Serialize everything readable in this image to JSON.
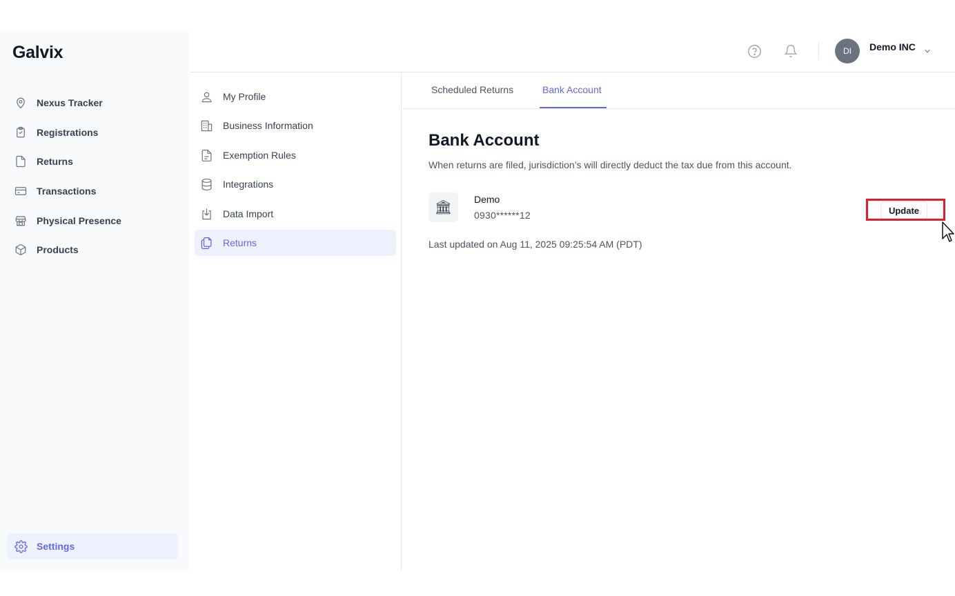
{
  "brand": {
    "logo": "Galvix"
  },
  "sidebar": {
    "items": [
      {
        "label": "Nexus Tracker",
        "icon": "map-pin-icon"
      },
      {
        "label": "Registrations",
        "icon": "clipboard-icon"
      },
      {
        "label": "Returns",
        "icon": "file-icon"
      },
      {
        "label": "Transactions",
        "icon": "credit-card-icon"
      },
      {
        "label": "Physical Presence",
        "icon": "storefront-icon"
      },
      {
        "label": "Products",
        "icon": "box-icon"
      }
    ],
    "settings": {
      "label": "Settings",
      "icon": "gear-icon"
    }
  },
  "header": {
    "help_icon": "help-circle-icon",
    "notifications_icon": "bell-icon",
    "avatar_initials": "DI",
    "org_name": "Demo INC"
  },
  "subnav": {
    "items": [
      {
        "label": "My Profile",
        "icon": "user-icon"
      },
      {
        "label": "Business Information",
        "icon": "building-icon"
      },
      {
        "label": "Exemption Rules",
        "icon": "document-icon"
      },
      {
        "label": "Integrations",
        "icon": "database-icon"
      },
      {
        "label": "Data Import",
        "icon": "download-icon"
      },
      {
        "label": "Returns",
        "icon": "copy-icon",
        "active": true
      }
    ]
  },
  "main": {
    "tabs": [
      {
        "label": "Scheduled Returns"
      },
      {
        "label": "Bank Account",
        "active": true
      }
    ],
    "title": "Bank Account",
    "description": "When returns are filed, jurisdiction’s will directly deduct the tax due from this account.",
    "bank": {
      "icon_glyph": "🏛",
      "name": "Demo",
      "account_masked": "0930******12"
    },
    "update_label": "Update",
    "last_updated": "Last updated on Aug 11, 2025 09:25:54 AM (PDT)"
  },
  "colors": {
    "accent": "#6366f1",
    "highlight": "#e11d2e",
    "sidebar_bg": "#f9fafb",
    "active_bg": "#eef2ff"
  }
}
